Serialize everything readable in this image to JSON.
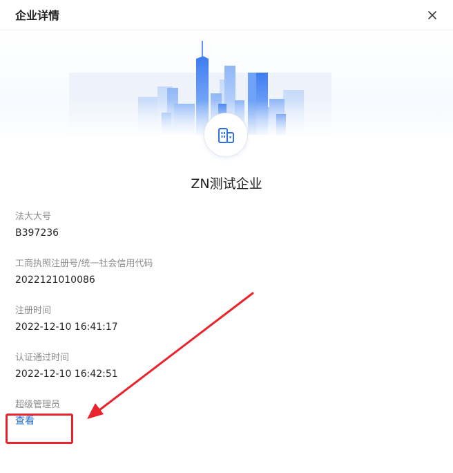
{
  "dialog": {
    "title": "企业详情",
    "close_icon": "close-icon"
  },
  "company": {
    "logo_icon": "building-icon",
    "name": "ZN测试企业"
  },
  "fields": [
    {
      "label": "法大大号",
      "value": "B397236"
    },
    {
      "label": "工商执照注册号/统一社会信用代码",
      "value": "2022121010086"
    },
    {
      "label": "注册时间",
      "value": "2022-12-10 16:41:17"
    },
    {
      "label": "认证通过时间",
      "value": "2022-12-10 16:42:51"
    }
  ],
  "super_admin": {
    "label": "超级管理员",
    "link": "查看"
  },
  "colors": {
    "link": "#1e6fd9",
    "annotation": "#e8242c",
    "accent_blue": "#3b82f6"
  }
}
